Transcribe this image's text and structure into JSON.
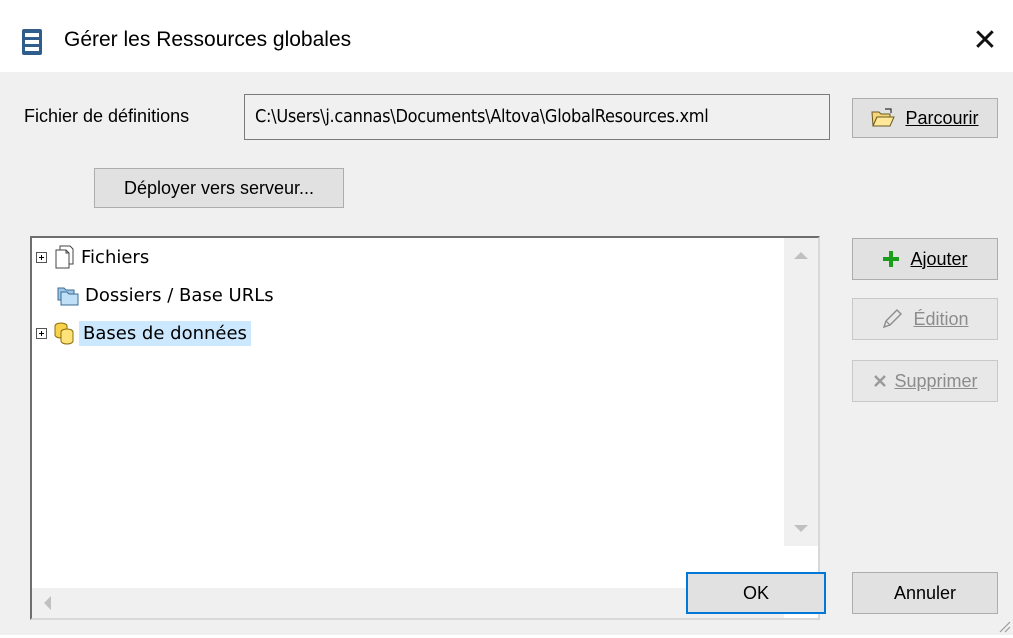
{
  "window": {
    "title": "Gérer les Ressources globales",
    "close_glyph": "✕",
    "icon": "global-resources-icon"
  },
  "definitions": {
    "label": "Fichier de définitions",
    "path": "C:\\Users\\j.cannas\\Documents\\Altova\\GlobalResources.xml",
    "browse_label": "Parcourir"
  },
  "deploy": {
    "label": "Déployer vers serveur..."
  },
  "tree": {
    "items": [
      {
        "label": "Fichiers",
        "icon": "files-icon",
        "expandable": true,
        "selected": false
      },
      {
        "label": "Dossiers / Base URLs",
        "icon": "folders-icon",
        "expandable": false,
        "selected": false
      },
      {
        "label": "Bases de données",
        "icon": "databases-icon",
        "expandable": true,
        "selected": true
      }
    ]
  },
  "actions": {
    "add_label": "Ajouter",
    "edit_label": "Édition",
    "delete_label": "Supprimer",
    "edit_enabled": false,
    "delete_enabled": false
  },
  "footer": {
    "ok_label": "OK",
    "cancel_label": "Annuler"
  },
  "colors": {
    "accent": "#0078d7",
    "selection": "#cce8ff",
    "dialog_bg": "#f0f0f0",
    "add_plus": "#1a9e1a"
  }
}
